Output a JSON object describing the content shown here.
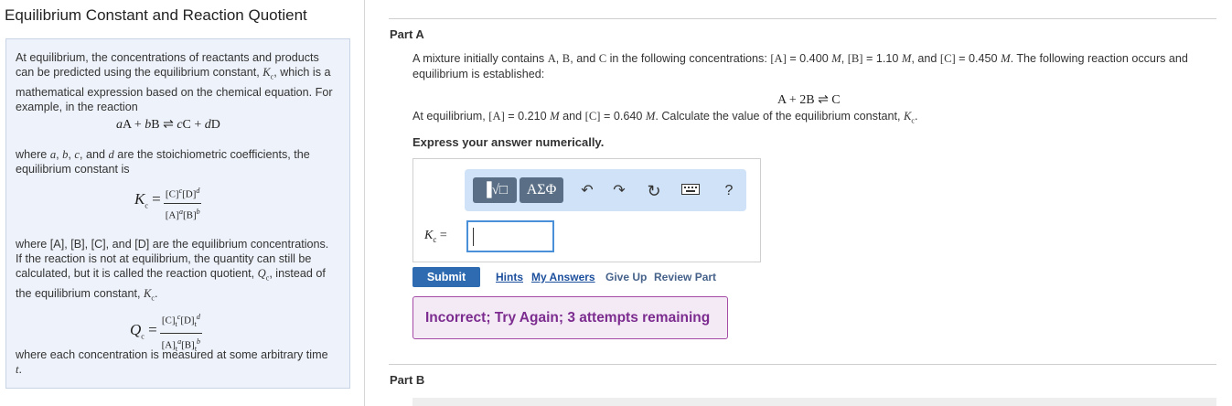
{
  "left": {
    "title": "Equilibrium Constant and Reaction Quotient",
    "intro": "At equilibrium, the concentrations of reactants and products can be predicted using the equilibrium constant, Kc, which is a mathematical expression based on the chemical equation. For example, in the reaction",
    "general_reaction": "aA + bB ⇌ cC + dD",
    "coeff_text": "where a, b, c, and d are the stoichiometric coefficients, the equilibrium constant is",
    "kc_lhs": "Kc =",
    "kc_num": "[C]^c[D]^d",
    "kc_den": "[A]^a[B]^b",
    "not_eq_text": "where [A], [B], [C], and [D] are the equilibrium concentrations. If the reaction is not at equilibrium, the quantity can still be calculated, but it is called the reaction quotient, Qc, instead of the equilibrium constant, Kc.",
    "qc_lhs": "Qc =",
    "qc_num": "[C]t^c[D]t^d",
    "qc_den": "[A]t^a[B]t^b",
    "arbitrary_text": "where each concentration is measured at some arbitrary time t."
  },
  "partA": {
    "title": "Part A",
    "problem": "A mixture initially contains A, B, and C in the following concentrations: [A] = 0.400 M, [B] = 1.10 M, and [C] = 0.450 M. The following reaction occurs and equilibrium is established:",
    "reaction": "A + 2B ⇌ C",
    "eq_conditions": "At equilibrium, [A] = 0.210 M and [C] = 0.640 M. Calculate the value of the equilibrium constant, Kc.",
    "instruction": "Express your answer numerically.",
    "toolbar": {
      "template_label": "▐√□",
      "greek_label": "ΑΣΦ",
      "help_label": "?"
    },
    "answer_label": "Kc =",
    "answer_value": "",
    "submit_label": "Submit",
    "links": {
      "hints": "Hints",
      "my_answers": "My Answers",
      "give_up": "Give Up",
      "review_part": "Review Part"
    },
    "feedback": "Incorrect; Try Again; 3 attempts remaining"
  },
  "partB": {
    "title": "Part B"
  }
}
